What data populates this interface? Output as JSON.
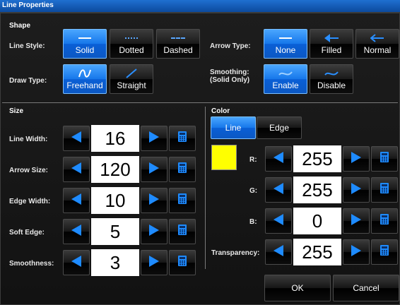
{
  "window": {
    "title": "Line Properties"
  },
  "shape": {
    "header": "Shape",
    "line_style": {
      "label": "Line Style:",
      "options": [
        "Solid",
        "Dotted",
        "Dashed"
      ],
      "selected": "Solid"
    },
    "arrow_type": {
      "label": "Arrow Type:",
      "options": [
        "None",
        "Filled",
        "Normal"
      ],
      "selected": "None"
    },
    "draw_type": {
      "label": "Draw Type:",
      "options": [
        "Freehand",
        "Straight"
      ],
      "selected": "Freehand"
    },
    "smoothing": {
      "label_line1": "Smoothing:",
      "label_line2": "(Solid Only)",
      "options": [
        "Enable",
        "Disable"
      ],
      "selected": "Enable"
    }
  },
  "size": {
    "header": "Size",
    "rows": [
      {
        "label": "Line Width:",
        "value": "16"
      },
      {
        "label": "Arrow Size:",
        "value": "120"
      },
      {
        "label": "Edge Width:",
        "value": "10"
      },
      {
        "label": "Soft Edge:",
        "value": "5"
      },
      {
        "label": "Smoothness:",
        "value": "3"
      }
    ]
  },
  "color": {
    "header": "Color",
    "tabs": [
      "Line",
      "Edge"
    ],
    "selected_tab": "Line",
    "swatch": "#ffff00",
    "rows": [
      {
        "label": "R:",
        "value": "255"
      },
      {
        "label": "G:",
        "value": "255"
      },
      {
        "label": "B:",
        "value": "0"
      },
      {
        "label": "Transparency:",
        "value": "255"
      }
    ]
  },
  "footer": {
    "ok": "OK",
    "cancel": "Cancel"
  },
  "colors": {
    "accent": "#1677ea",
    "arrow": "#1e8bff",
    "background": "#151515"
  }
}
